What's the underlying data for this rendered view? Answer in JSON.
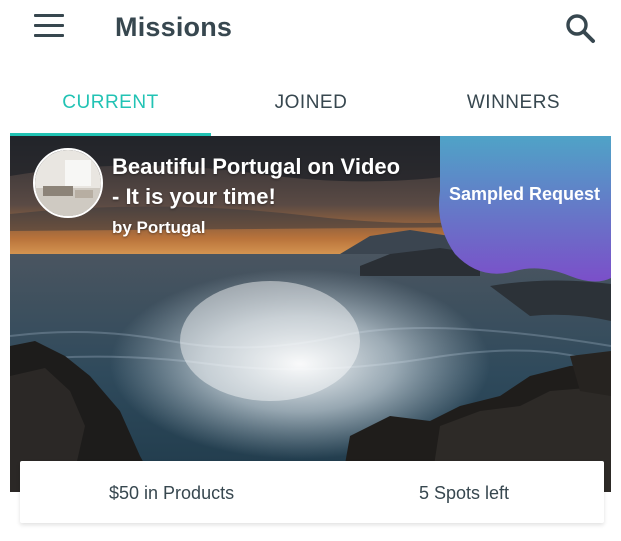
{
  "appbar": {
    "title": "Missions",
    "menu_icon": "hamburger-menu-icon",
    "search_icon": "search-icon"
  },
  "tabs": [
    {
      "label": "CURRENT",
      "active": true
    },
    {
      "label": "JOINED",
      "active": false
    },
    {
      "label": "WINNERS",
      "active": false
    }
  ],
  "colors": {
    "accent": "#22c3b4",
    "text": "#37474f",
    "badge_top": "#4fa3c7",
    "badge_bottom": "#7b4fc9"
  },
  "mission": {
    "title": "Beautiful Portugal on Video - It is your time!",
    "by": "by Portugal",
    "type_badge": "Sampled Request",
    "reward": "$50 in Products",
    "spots": "5 Spots left"
  }
}
